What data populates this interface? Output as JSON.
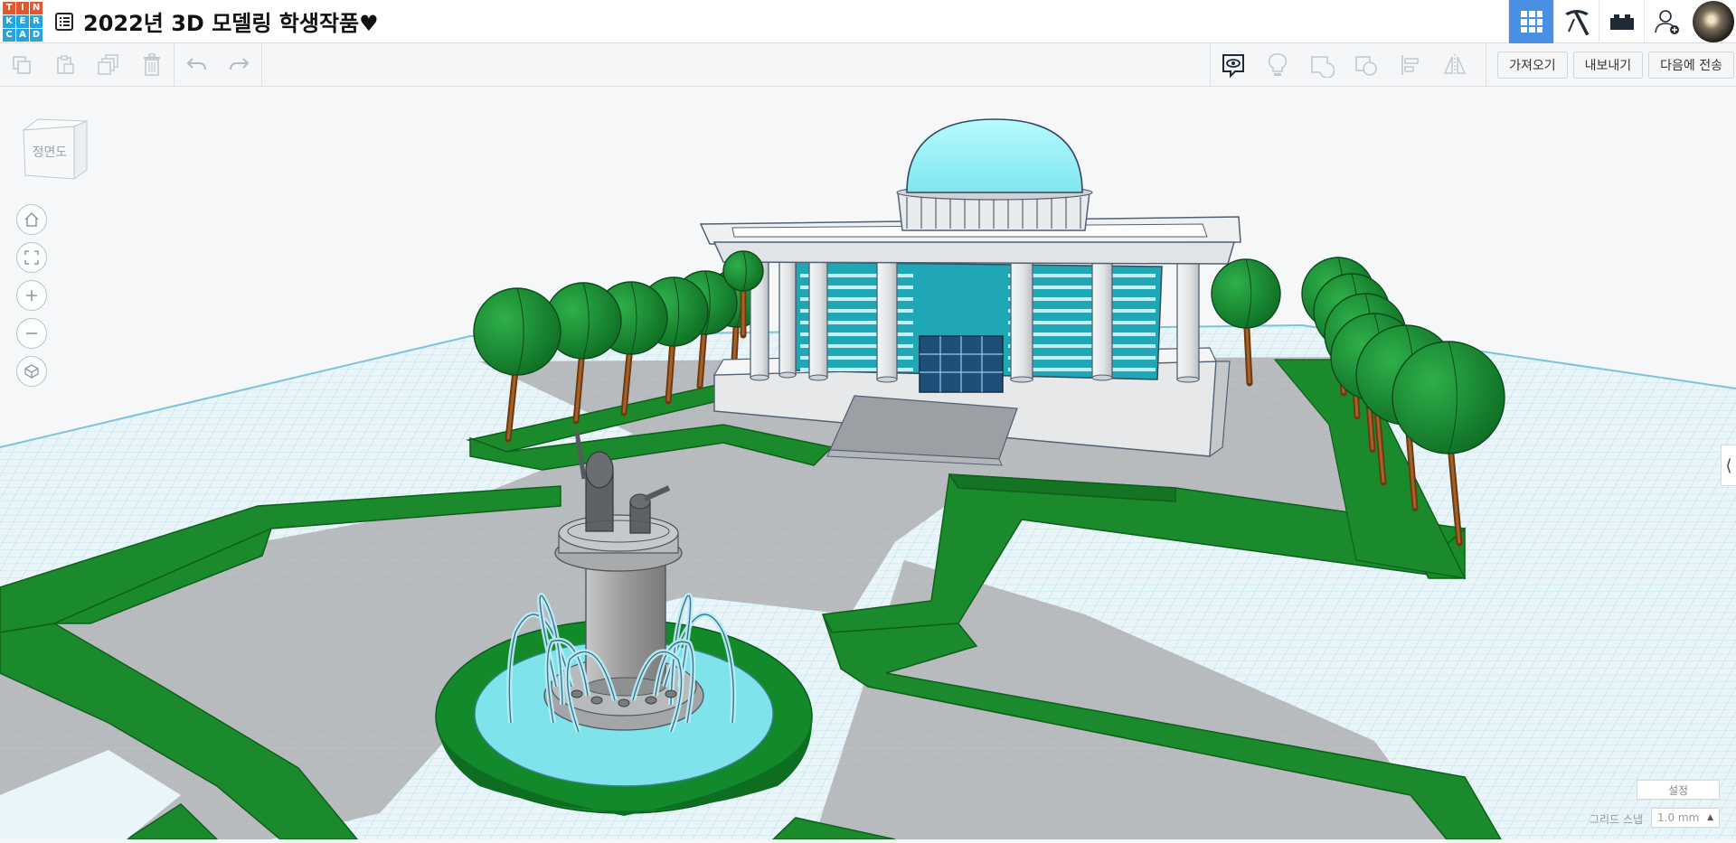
{
  "app": {
    "logo_letters": [
      "T",
      "I",
      "N",
      "K",
      "E",
      "R",
      "C",
      "A",
      "D"
    ],
    "logo_colors": [
      "#e4572e",
      "#e4572e",
      "#e4572e",
      "#29a3db",
      "#29a3db",
      "#29a3db",
      "#29a3db",
      "#29a3db",
      "#29a3db"
    ],
    "title": "2022년 3D 모델링 학생작품♥"
  },
  "topbar": {
    "buttons": [
      {
        "name": "3d-design-view",
        "icon": "grid-icon",
        "active": true
      },
      {
        "name": "codeblocks-view",
        "icon": "pickaxe-icon",
        "active": false
      },
      {
        "name": "bricks-view",
        "icon": "brick-icon",
        "active": false
      },
      {
        "name": "invite-user",
        "icon": "add-user-icon",
        "active": false
      }
    ]
  },
  "toolbar": {
    "left_tools": [
      {
        "name": "copy",
        "icon": "copy-icon"
      },
      {
        "name": "paste",
        "icon": "paste-icon"
      },
      {
        "name": "duplicate",
        "icon": "duplicate-icon"
      },
      {
        "name": "delete",
        "icon": "trash-icon"
      },
      {
        "name": "undo",
        "icon": "undo-icon"
      },
      {
        "name": "redo",
        "icon": "redo-icon"
      }
    ],
    "right_tools": [
      {
        "name": "notes",
        "icon": "comment-eye-icon"
      },
      {
        "name": "show-all",
        "icon": "lightbulb-icon"
      },
      {
        "name": "group",
        "icon": "group-icon"
      },
      {
        "name": "ungroup",
        "icon": "ungroup-icon"
      },
      {
        "name": "align",
        "icon": "align-icon"
      },
      {
        "name": "mirror",
        "icon": "mirror-icon"
      }
    ],
    "import_label": "가져오기",
    "export_label": "내보내기",
    "send_to_label": "다음에 전송"
  },
  "viewcube": {
    "label": "정면도"
  },
  "nav": [
    {
      "name": "home-view",
      "icon": "home-icon"
    },
    {
      "name": "fit-view",
      "icon": "fit-icon"
    },
    {
      "name": "zoom-in",
      "icon": "plus-icon"
    },
    {
      "name": "zoom-out",
      "icon": "minus-icon"
    },
    {
      "name": "perspective",
      "icon": "cube-icon"
    }
  ],
  "bottom": {
    "settings_label": "설정",
    "grid_snap_label": "그리드 스냅",
    "grid_snap_value": "1.0 mm"
  },
  "colors": {
    "accent": "#4a90e2",
    "grass": "#1b8a2c",
    "path": "#b9bcbf",
    "building": "#e6e8ea",
    "glass": "#1fa7b5",
    "dome": "#9ff2f7",
    "water": "#7fe3ec"
  }
}
